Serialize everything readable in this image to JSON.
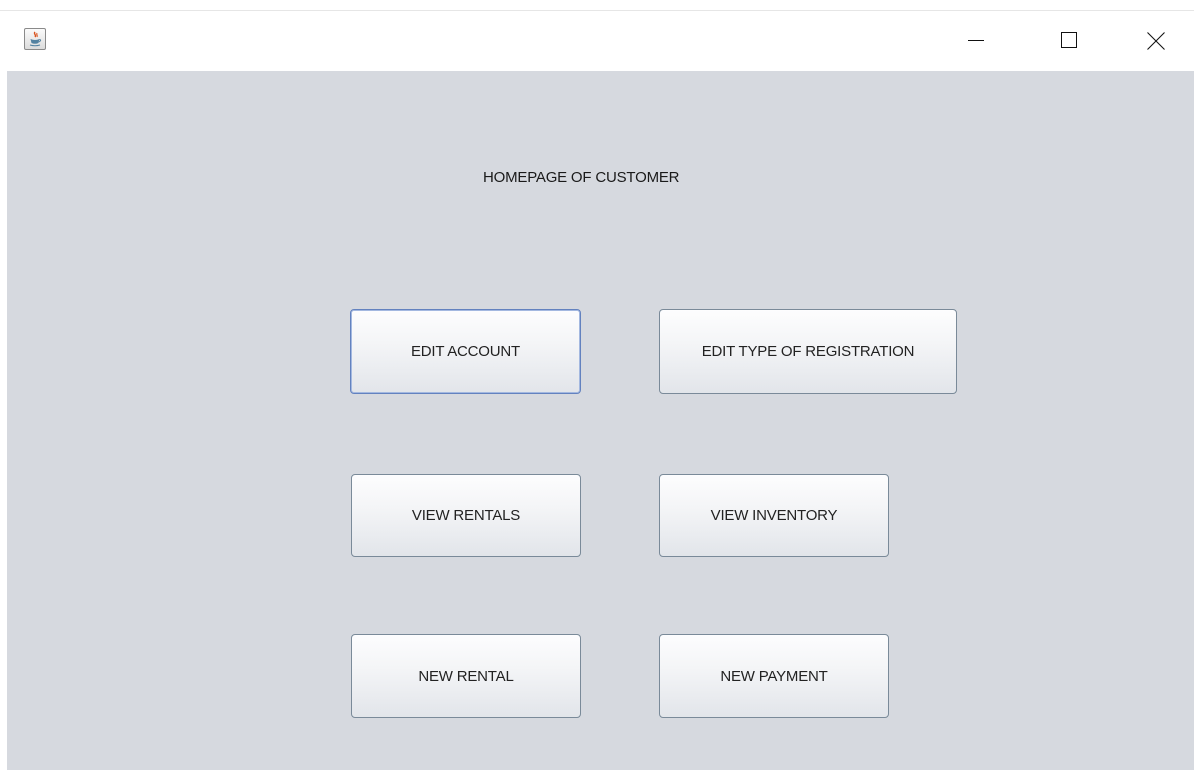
{
  "window": {
    "icon": "java-cup-icon",
    "controls": {
      "minimize": "minimize-icon",
      "maximize": "maximize-icon",
      "close": "close-icon"
    }
  },
  "main": {
    "title": "HOMEPAGE OF CUSTOMER",
    "buttons": {
      "edit_account": "EDIT ACCOUNT",
      "edit_type_of_registration": "EDIT TYPE OF REGISTRATION",
      "view_rentals": "VIEW RENTALS",
      "view_inventory": "VIEW INVENTORY",
      "new_rental": "NEW RENTAL",
      "new_payment": "NEW PAYMENT"
    }
  },
  "colors": {
    "content_background": "#d6d9df",
    "focus_border": "#6382bf"
  }
}
